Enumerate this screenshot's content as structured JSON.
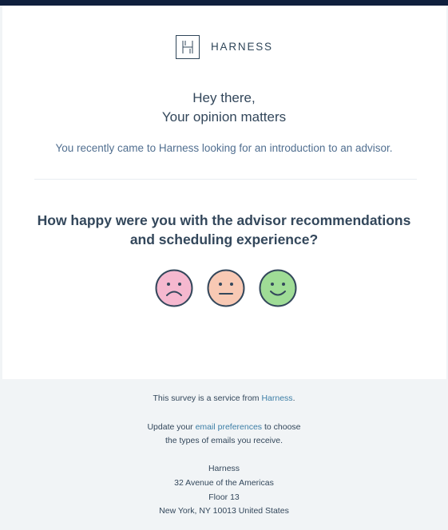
{
  "brand": {
    "logo_letter": "H",
    "name": "HARNESS",
    "colors": {
      "top_bar": "#0f1f3d",
      "text_dark": "#33475b",
      "link": "#3c7ea6",
      "footer_bg": "#f1f4f6"
    }
  },
  "greeting": {
    "line1": "Hey there,",
    "line2": "Your opinion matters"
  },
  "intro_text": "You recently came to Harness looking for an introduction to an advisor.",
  "question": {
    "line1": "How happy were you with the advisor recommendations",
    "line2": "and scheduling experience?"
  },
  "ratings": [
    {
      "name": "sad",
      "icon": "sad-face-icon",
      "color": "#f5b8cf"
    },
    {
      "name": "neutral",
      "icon": "neutral-face-icon",
      "color": "#f8c9b4"
    },
    {
      "name": "happy",
      "icon": "happy-face-icon",
      "color": "#9fdc96"
    }
  ],
  "footer": {
    "service_prefix": "This survey is a service from ",
    "service_link": "Harness",
    "service_suffix": ".",
    "update_prefix": "Update your ",
    "update_link": "email preferences",
    "update_suffix": " to choose",
    "update_line2": "the types of emails you receive.",
    "address": {
      "company": "Harness",
      "street": "32 Avenue of the Americas",
      "floor": "Floor 13",
      "city": "New York, NY 10013 United States"
    }
  }
}
